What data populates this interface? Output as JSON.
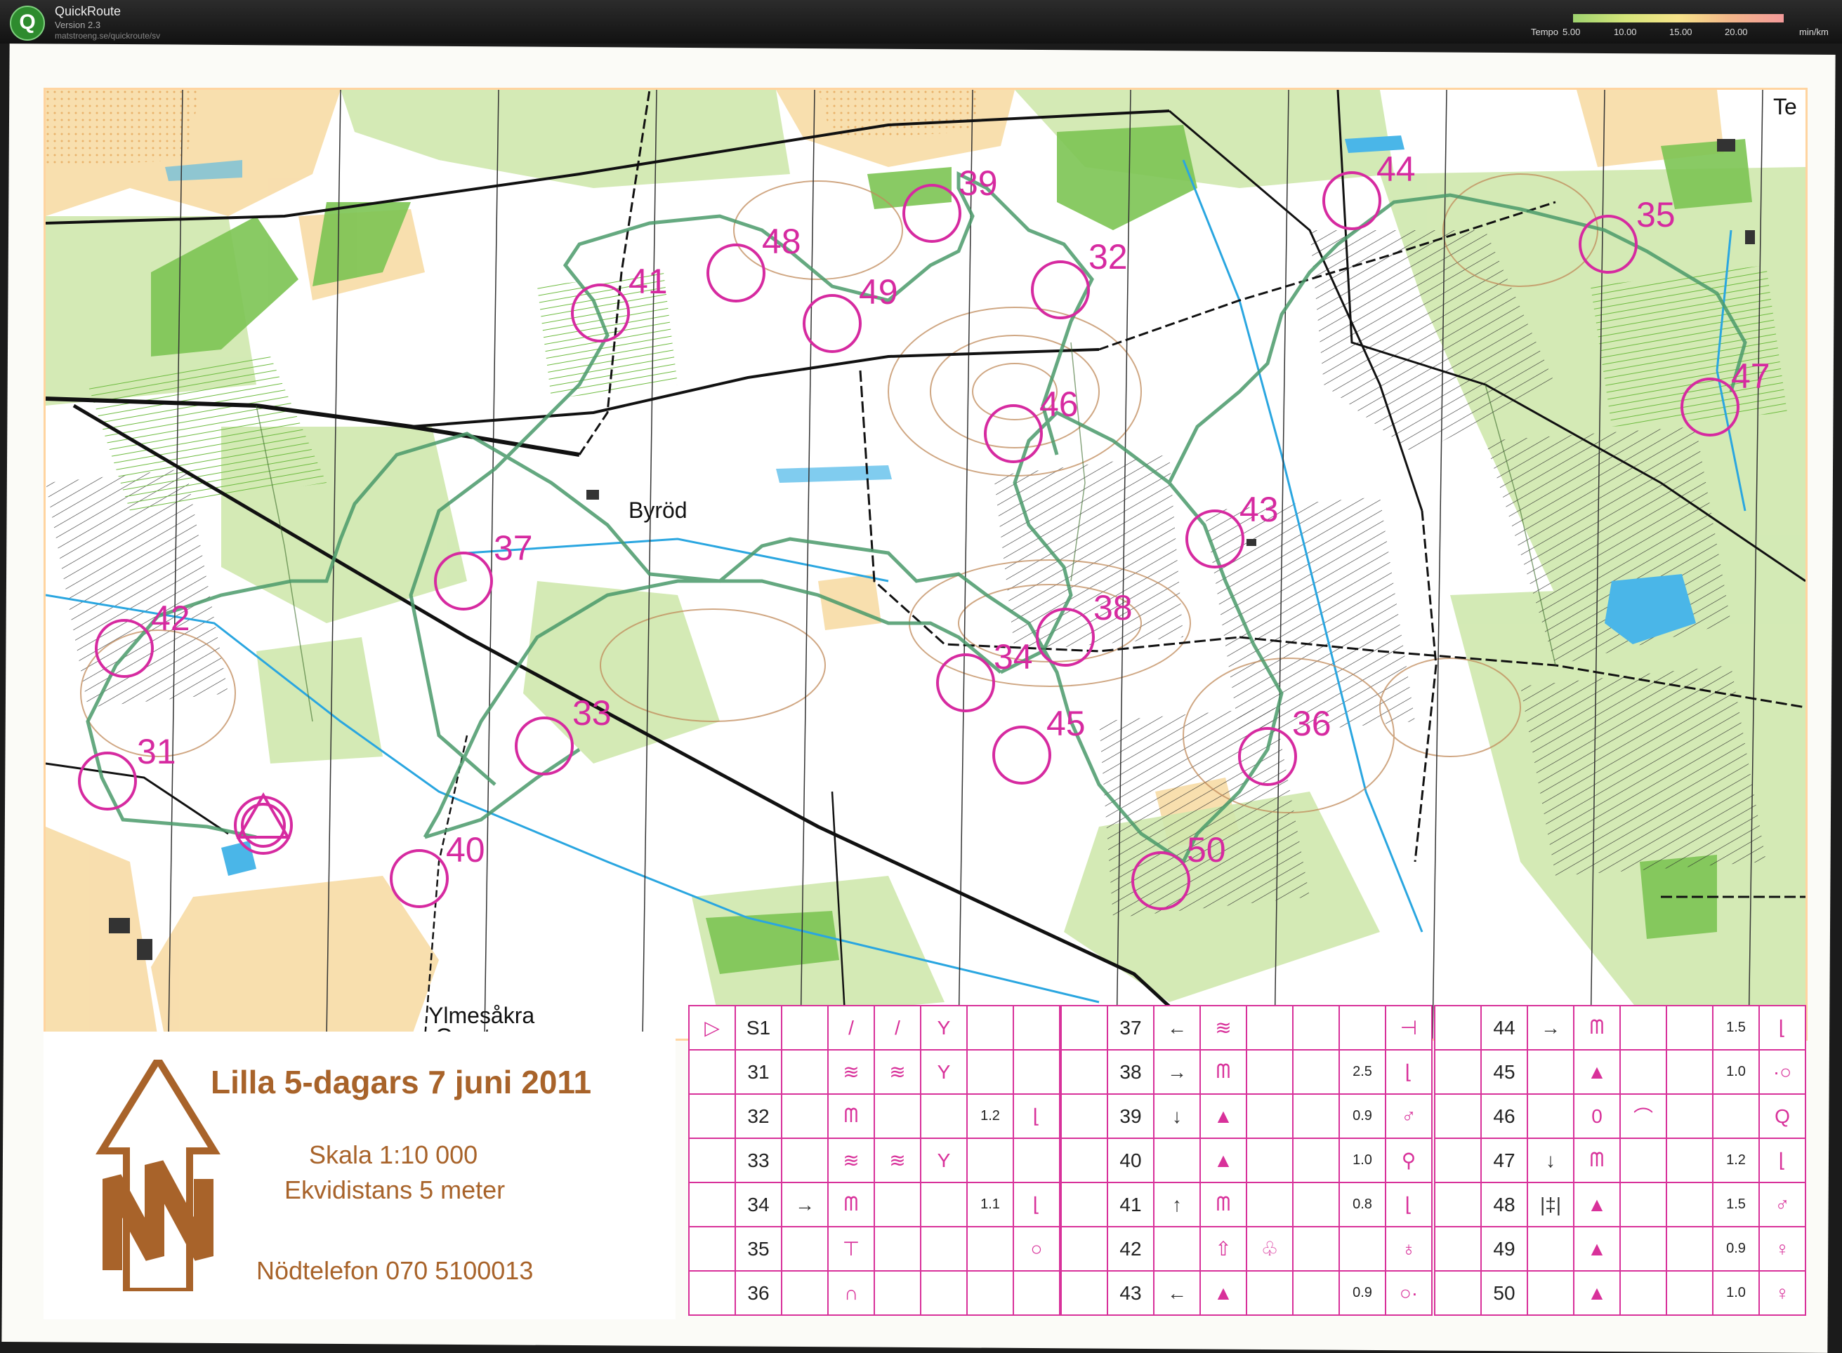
{
  "app": {
    "title": "QuickRoute",
    "version": "Version 2.3",
    "url": "matstroeng.se/quickroute/sv",
    "logo_letter": "Q"
  },
  "pace_legend": {
    "label": "Tempo",
    "ticks": [
      "5.00",
      "10.00",
      "15.00",
      "20.00"
    ],
    "unit": "min/km"
  },
  "map": {
    "place_names": [
      "Byröd",
      "Ylmesåkra",
      "Grustag",
      "Te"
    ],
    "controls": [
      {
        "code": "31"
      },
      {
        "code": "32"
      },
      {
        "code": "33"
      },
      {
        "code": "34"
      },
      {
        "code": "35"
      },
      {
        "code": "36"
      },
      {
        "code": "37"
      },
      {
        "code": "38"
      },
      {
        "code": "39"
      },
      {
        "code": "40"
      },
      {
        "code": "41"
      },
      {
        "code": "42"
      },
      {
        "code": "43"
      },
      {
        "code": "44"
      },
      {
        "code": "45"
      },
      {
        "code": "46"
      },
      {
        "code": "47"
      },
      {
        "code": "48"
      },
      {
        "code": "49"
      },
      {
        "code": "50"
      }
    ],
    "colors": {
      "open_land": "#f7d9a0",
      "forest_green": "#c5e3a0",
      "dark_green": "#7cc453",
      "water": "#2aa6e0",
      "control": "#d62aa0",
      "route": "#4a9a6a",
      "road": "#111111",
      "contour": "#c08a5a"
    }
  },
  "info": {
    "title": "Lilla 5-dagars 7 juni 2011",
    "scale": "Skala 1:10 000",
    "contour": "Ekvidistans 5 meter",
    "phone": "Nödtelefon 070 5100013"
  },
  "descriptions": {
    "col1": [
      {
        "start_symbol": "▷",
        "code": "S1",
        "c": "",
        "d": "/",
        "e": "/",
        "f": "Y",
        "g": "",
        "h": ""
      },
      {
        "code": "31",
        "c": "",
        "d": "≋",
        "e": "≋",
        "f": "Y",
        "g": "",
        "h": ""
      },
      {
        "code": "32",
        "c": "",
        "d": "ᗰ",
        "e": "",
        "f": "",
        "g": "1.2",
        "h": "⌊"
      },
      {
        "code": "33",
        "c": "",
        "d": "≋",
        "e": "≋",
        "f": "Y",
        "g": "",
        "h": ""
      },
      {
        "code": "34",
        "c": "→",
        "d": "ᗰ",
        "e": "",
        "f": "",
        "g": "1.1",
        "h": "⌊"
      },
      {
        "code": "35",
        "c": "",
        "d": "⊤",
        "e": "",
        "f": "",
        "g": "",
        "h": "○"
      },
      {
        "code": "36",
        "c": "",
        "d": "∩",
        "e": "",
        "f": "",
        "g": "",
        "h": ""
      }
    ],
    "col2": [
      {
        "code": "37",
        "c": "←",
        "d": "≋",
        "e": "",
        "f": "",
        "g": "",
        "h": "⊣"
      },
      {
        "code": "38",
        "c": "→",
        "d": "ᗰ",
        "e": "",
        "f": "",
        "g": "2.5",
        "h": "⌊"
      },
      {
        "code": "39",
        "c": "↓",
        "d": "▲",
        "e": "",
        "f": "",
        "g": "0.9",
        "h": "♂"
      },
      {
        "code": "40",
        "c": "",
        "d": "▲",
        "e": "",
        "f": "",
        "g": "1.0",
        "h": "⚲"
      },
      {
        "code": "41",
        "c": "↑",
        "d": "ᗰ",
        "e": "",
        "f": "",
        "g": "0.8",
        "h": "⌊"
      },
      {
        "code": "42",
        "c": "",
        "d": "⇧",
        "e": "♧",
        "f": "",
        "g": "",
        "h": "♁"
      },
      {
        "code": "43",
        "c": "←",
        "d": "▲",
        "e": "",
        "f": "",
        "g": "0.9",
        "h": "○·"
      }
    ],
    "col3": [
      {
        "code": "44",
        "c": "→",
        "d": "ᗰ",
        "e": "",
        "f": "",
        "g": "1.5",
        "h": "⌊"
      },
      {
        "code": "45",
        "c": "",
        "d": "▲",
        "e": "",
        "f": "",
        "g": "1.0",
        "h": "·○"
      },
      {
        "code": "46",
        "c": "",
        "d": "0",
        "e": "⌒",
        "f": "",
        "g": "",
        "h": "Q"
      },
      {
        "code": "47",
        "c": "↓",
        "d": "ᗰ",
        "e": "",
        "f": "",
        "g": "1.2",
        "h": "⌊"
      },
      {
        "code": "48",
        "c": "|‡|",
        "d": "▲",
        "e": "",
        "f": "",
        "g": "1.5",
        "h": "♂"
      },
      {
        "code": "49",
        "c": "",
        "d": "▲",
        "e": "",
        "f": "",
        "g": "0.9",
        "h": "♀"
      },
      {
        "code": "50",
        "c": "",
        "d": "▲",
        "e": "",
        "f": "",
        "g": "1.0",
        "h": "♀"
      }
    ]
  }
}
